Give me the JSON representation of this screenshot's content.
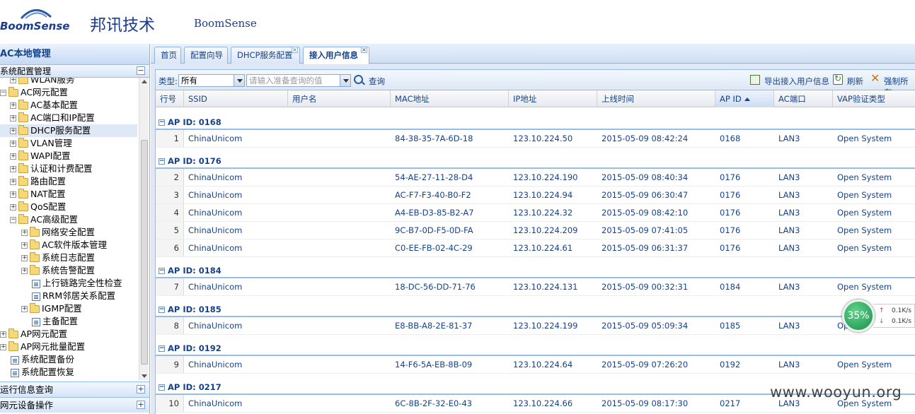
{
  "header": {
    "logo_text": "BoomSense",
    "brand_cn": "邦讯技术",
    "brand_en": "BoomSense"
  },
  "sidebar": {
    "title": "AC本地管理",
    "panel_title": "系统配置管理",
    "tree": [
      {
        "label": "WLAN服务",
        "level": 1,
        "type": "folder",
        "toggle": "+"
      },
      {
        "label": "AC网元配置",
        "level": 0,
        "type": "folder",
        "toggle": "-"
      },
      {
        "label": "AC基本配置",
        "level": 1,
        "type": "folder",
        "toggle": "+"
      },
      {
        "label": "AC端口和IP配置",
        "level": 1,
        "type": "folder",
        "toggle": "+"
      },
      {
        "label": "DHCP服务配置",
        "level": 1,
        "type": "folder",
        "toggle": "+",
        "selected": true
      },
      {
        "label": "VLAN管理",
        "level": 1,
        "type": "folder",
        "toggle": "+"
      },
      {
        "label": "WAPI配置",
        "level": 1,
        "type": "folder",
        "toggle": "+"
      },
      {
        "label": "认证和计费配置",
        "level": 1,
        "type": "folder",
        "toggle": "+"
      },
      {
        "label": "路由配置",
        "level": 1,
        "type": "folder",
        "toggle": "+"
      },
      {
        "label": "NAT配置",
        "level": 1,
        "type": "folder",
        "toggle": "+"
      },
      {
        "label": "QoS配置",
        "level": 1,
        "type": "folder",
        "toggle": "+"
      },
      {
        "label": "AC高级配置",
        "level": 1,
        "type": "folder",
        "toggle": "-"
      },
      {
        "label": "网络安全配置",
        "level": 2,
        "type": "folder",
        "toggle": "+"
      },
      {
        "label": "AC软件版本管理",
        "level": 2,
        "type": "folder",
        "toggle": "+"
      },
      {
        "label": "系统日志配置",
        "level": 2,
        "type": "folder",
        "toggle": "+"
      },
      {
        "label": "系统告警配置",
        "level": 2,
        "type": "folder",
        "toggle": "+"
      },
      {
        "label": "上行链路完全性检查",
        "level": 2,
        "type": "leaf",
        "toggle": ""
      },
      {
        "label": "RRM邻居关系配置",
        "level": 2,
        "type": "leaf",
        "toggle": ""
      },
      {
        "label": "IGMP配置",
        "level": 2,
        "type": "folder",
        "toggle": "+"
      },
      {
        "label": "主备配置",
        "level": 2,
        "type": "leaf",
        "toggle": ""
      },
      {
        "label": "AP网元配置",
        "level": 0,
        "type": "folder",
        "toggle": "+"
      },
      {
        "label": "AP网元批量配置",
        "level": 0,
        "type": "folder",
        "toggle": "+"
      },
      {
        "label": "系统配置备份",
        "level": 0,
        "type": "leaf",
        "toggle": ""
      },
      {
        "label": "系统配置恢复",
        "level": 0,
        "type": "leaf",
        "toggle": ""
      }
    ],
    "bottom_panels": [
      "运行信息查询",
      "网元设备操作"
    ]
  },
  "tabs": [
    {
      "label": "首页",
      "closable": false
    },
    {
      "label": "配置向导",
      "closable": false
    },
    {
      "label": "DHCP服务配置",
      "closable": true
    },
    {
      "label": "接入用户信息",
      "closable": true,
      "active": true
    }
  ],
  "toolbar": {
    "type_label": "类型:",
    "type_value": "所有",
    "query_placeholder": "请输入准备查询的值",
    "query_label": "查询",
    "export_label": "导出接入用户信息",
    "refresh_label": "刷新",
    "force_label": "强制所有"
  },
  "grid": {
    "columns": [
      "行号",
      "SSID",
      "用户名",
      "MAC地址",
      "IP地址",
      "上线时间",
      "AP ID",
      "AC端口",
      "VAP验证类型"
    ],
    "groups": [
      {
        "title": "AP ID: 0168",
        "rows": [
          {
            "n": "1",
            "ssid": "ChinaUnicom",
            "user": "",
            "mac": "84-38-35-7A-6D-18",
            "ip": "123.10.224.50",
            "time": "2015-05-09 08:42:24",
            "ap": "0168",
            "port": "LAN3",
            "vap": "Open System"
          }
        ]
      },
      {
        "title": "AP ID: 0176",
        "rows": [
          {
            "n": "2",
            "ssid": "ChinaUnicom",
            "user": "",
            "mac": "54-AE-27-11-28-D4",
            "ip": "123.10.224.190",
            "time": "2015-05-09 08:40:34",
            "ap": "0176",
            "port": "LAN3",
            "vap": "Open System"
          },
          {
            "n": "3",
            "ssid": "ChinaUnicom",
            "user": "",
            "mac": "AC-F7-F3-40-B0-F2",
            "ip": "123.10.224.94",
            "time": "2015-05-09 06:30:47",
            "ap": "0176",
            "port": "LAN3",
            "vap": "Open System"
          },
          {
            "n": "4",
            "ssid": "ChinaUnicom",
            "user": "",
            "mac": "A4-EB-D3-85-B2-A7",
            "ip": "123.10.224.32",
            "time": "2015-05-09 08:42:10",
            "ap": "0176",
            "port": "LAN3",
            "vap": "Open System"
          },
          {
            "n": "5",
            "ssid": "ChinaUnicom",
            "user": "",
            "mac": "9C-B7-0D-F5-0D-FA",
            "ip": "123.10.224.209",
            "time": "2015-05-09 07:41:05",
            "ap": "0176",
            "port": "LAN3",
            "vap": "Open System"
          },
          {
            "n": "6",
            "ssid": "ChinaUnicom",
            "user": "",
            "mac": "C0-EE-FB-02-4C-29",
            "ip": "123.10.224.61",
            "time": "2015-05-09 06:31:37",
            "ap": "0176",
            "port": "LAN3",
            "vap": "Open System"
          }
        ]
      },
      {
        "title": "AP ID: 0184",
        "rows": [
          {
            "n": "7",
            "ssid": "ChinaUnicom",
            "user": "",
            "mac": "18-DC-56-DD-71-76",
            "ip": "123.10.224.131",
            "time": "2015-05-09 00:32:31",
            "ap": "0184",
            "port": "LAN3",
            "vap": "Open System"
          }
        ]
      },
      {
        "title": "AP ID: 0185",
        "rows": [
          {
            "n": "8",
            "ssid": "ChinaUnicom",
            "user": "",
            "mac": "E8-BB-A8-2E-81-37",
            "ip": "123.10.224.199",
            "time": "2015-05-09 05:09:34",
            "ap": "0185",
            "port": "LAN3",
            "vap": "Op"
          }
        ]
      },
      {
        "title": "AP ID: 0192",
        "rows": [
          {
            "n": "9",
            "ssid": "ChinaUnicom",
            "user": "",
            "mac": "14-F6-5A-EB-8B-09",
            "ip": "123.10.224.64",
            "time": "2015-05-09 07:26:20",
            "ap": "0192",
            "port": "LAN3",
            "vap": "Open System"
          }
        ]
      },
      {
        "title": "AP ID: 0217",
        "rows": [
          {
            "n": "10",
            "ssid": "ChinaUnicom",
            "user": "",
            "mac": "6C-8B-2F-32-E0-43",
            "ip": "123.10.224.66",
            "time": "2015-05-09 08:17:30",
            "ap": "0217",
            "port": "LAN3",
            "vap": "Open System"
          }
        ]
      }
    ]
  },
  "net_widget": {
    "percent": "35%",
    "up": "0.1K/s",
    "down": "0.1K/s"
  },
  "watermark": "www.wooyun.org"
}
